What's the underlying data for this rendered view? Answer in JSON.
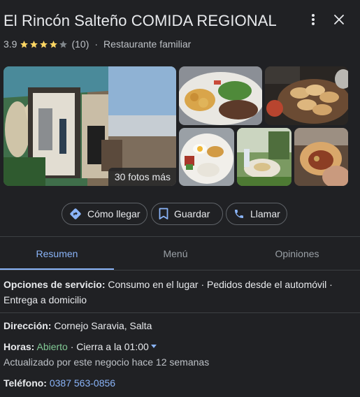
{
  "header": {
    "title": "El Rincón Salteño COMIDA REGIONAL",
    "menu_icon": "more-vert-icon",
    "close_icon": "close-icon"
  },
  "rating": {
    "score": "3.9",
    "stars_filled": 3.9,
    "stars_total": 5,
    "count": "(10)",
    "separator": "·",
    "category": "Restaurante familiar"
  },
  "photos": {
    "more_label": "30 fotos más"
  },
  "actions": [
    {
      "label": "Cómo llegar",
      "icon": "directions-icon"
    },
    {
      "label": "Guardar",
      "icon": "bookmark-icon"
    },
    {
      "label": "Llamar",
      "icon": "phone-icon"
    }
  ],
  "tabs": [
    {
      "label": "Resumen",
      "active": true
    },
    {
      "label": "Menú",
      "active": false
    },
    {
      "label": "Opiniones",
      "active": false
    }
  ],
  "service": {
    "label": "Opciones de servicio:",
    "value": "Consumo en el lugar · Pedidos desde el automóvil · Entrega a domicilio"
  },
  "address": {
    "label": "Dirección:",
    "value": "Cornejo Saravia, Salta"
  },
  "hours": {
    "label": "Horas:",
    "status": "Abierto",
    "detail": "· Cierra a la 01:00",
    "updated": "Actualizado por este negocio hace 12 semanas"
  },
  "phone": {
    "label": "Teléfono:",
    "value": "0387 563-0856"
  },
  "colors": {
    "background": "#202124",
    "accent": "#8ab4f8",
    "open": "#81c995",
    "star": "#fdd663"
  }
}
